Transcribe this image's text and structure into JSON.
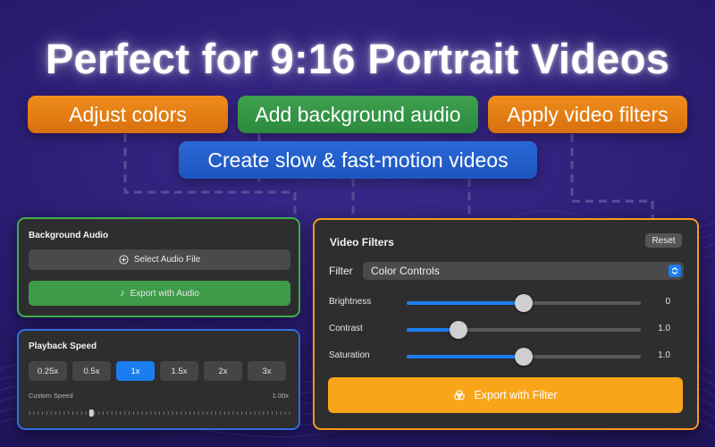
{
  "headline": "Perfect for 9:16 Portrait Videos",
  "features": {
    "adjust_colors": "Adjust colors",
    "background_audio": "Add background audio",
    "video_filters": "Apply video filters",
    "slow_fast_motion": "Create slow & fast-motion videos"
  },
  "audio_panel": {
    "title": "Background Audio",
    "select_label": "Select Audio File",
    "export_label": "Export with Audio"
  },
  "speed_panel": {
    "title": "Playback Speed",
    "options": [
      "0.25x",
      "0.5x",
      "1x",
      "1.5x",
      "2x",
      "3x"
    ],
    "selected": "1x",
    "custom_label": "Custom Speed",
    "custom_value": "1.00x",
    "custom_fraction": 0.24
  },
  "filter_panel": {
    "title": "Video Filters",
    "reset_label": "Reset",
    "filter_label": "Filter",
    "filter_value": "Color Controls",
    "sliders": [
      {
        "label": "Brightness",
        "value": "0",
        "fraction": 0.5
      },
      {
        "label": "Contrast",
        "value": "1.0",
        "fraction": 0.22
      },
      {
        "label": "Saturation",
        "value": "1.0",
        "fraction": 0.5
      }
    ],
    "export_label": "Export with Filter"
  },
  "colors": {
    "orange": "#f08d1c",
    "green": "#3ea04e",
    "blue": "#2a68d6",
    "accent": "#1b7ef0",
    "export_filter": "#f9a51a"
  }
}
